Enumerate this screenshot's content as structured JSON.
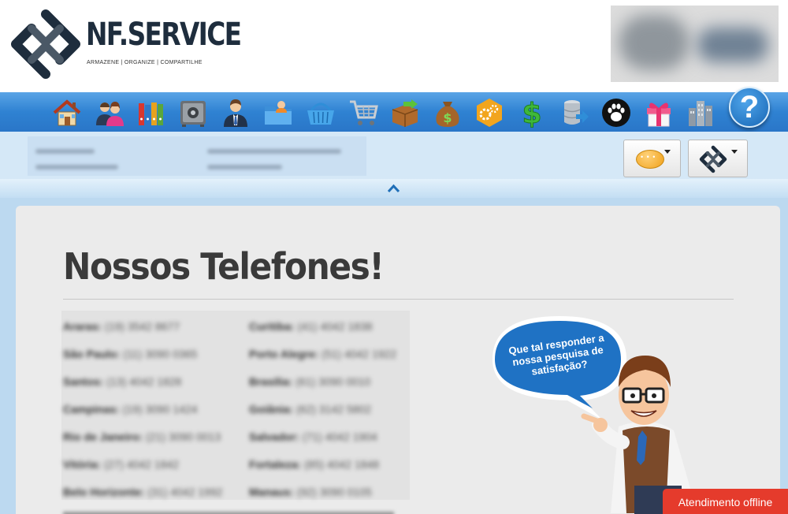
{
  "header": {
    "logo_brand": "NF.SERVICE",
    "logo_tagline": "ARMAZENE | ORGANIZE | COMPARTILHE"
  },
  "toolbar": {
    "items": [
      {
        "name": "home-icon"
      },
      {
        "name": "users-icon"
      },
      {
        "name": "binders-icon"
      },
      {
        "name": "safe-icon"
      },
      {
        "name": "businessman-icon"
      },
      {
        "name": "folder-user-icon"
      },
      {
        "name": "basket-icon"
      },
      {
        "name": "shopping-cart-icon"
      },
      {
        "name": "box-transfer-icon"
      },
      {
        "name": "money-bag-icon"
      },
      {
        "name": "gears-hexagon-icon"
      },
      {
        "name": "dollar-sign-icon"
      },
      {
        "name": "database-export-icon"
      },
      {
        "name": "paw-icon"
      },
      {
        "name": "gift-icon"
      },
      {
        "name": "buildings-icon"
      }
    ],
    "help_label": "?"
  },
  "main": {
    "title": "Nossos Telefones!",
    "phones_left": [
      {
        "city": "Araras:",
        "number": "(19) 3542 8677"
      },
      {
        "city": "São Paulo:",
        "number": "(11) 3090 0365"
      },
      {
        "city": "Santos:",
        "number": "(13) 4042 1828"
      },
      {
        "city": "Campinas:",
        "number": "(19) 3090 1424"
      },
      {
        "city": "Rio de Janeiro:",
        "number": "(21) 3090 0013"
      },
      {
        "city": "Vitória:",
        "number": "(27) 4042 1842"
      },
      {
        "city": "Belo Horizonte:",
        "number": "(31) 4042 1992"
      }
    ],
    "phones_right": [
      {
        "city": "Curitiba:",
        "number": "(41) 4042 1838"
      },
      {
        "city": "Porto Alegre:",
        "number": "(51) 4042 1922"
      },
      {
        "city": "Brasília:",
        "number": "(61) 3090 0010"
      },
      {
        "city": "Goiânia:",
        "number": "(62) 3142 5802"
      },
      {
        "city": "Salvador:",
        "number": "(71) 4042 1904"
      },
      {
        "city": "Fortaleza:",
        "number": "(85) 4042 1848"
      },
      {
        "city": "Manaus:",
        "number": "(92) 3090 0105"
      }
    ],
    "survey_text": "Que tal responder a nossa pesquisa de satisfação?"
  },
  "chat": {
    "offline_label": "Atendimento offline"
  },
  "colors": {
    "toolbar": "#2f82d2",
    "offline": "#e53b2c",
    "title": "#3a3a3a"
  }
}
